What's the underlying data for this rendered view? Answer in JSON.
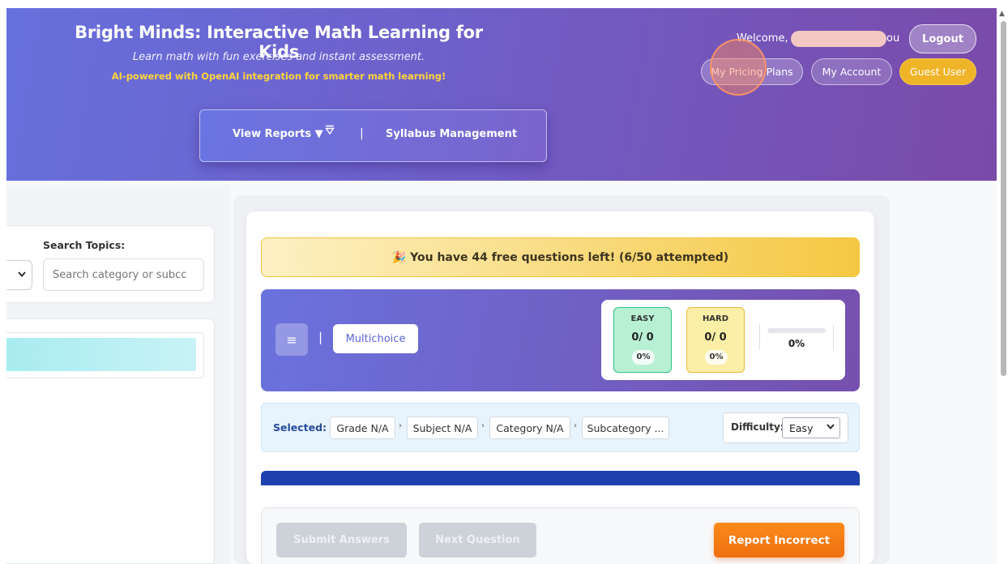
{
  "header": {
    "title": "Bright Minds: Interactive Math Learning for Kids",
    "subtitle": "Learn math with fun exercises and instant assessment.",
    "ai_line": "AI-powered with OpenAI integration for smarter math learning!",
    "nav": {
      "reports": "View Reports ▼",
      "filter_icon": "filter-icon",
      "separator": "|",
      "syllabus": "Syllabus Management"
    },
    "welcome_prefix": "Welcome,",
    "welcome_suffix": "ou",
    "logout": "Logout",
    "pricing": "My Pricing Plans",
    "account": "My Account",
    "guest": "Guest User"
  },
  "sidebar": {
    "search_label": "Search Topics:",
    "search_placeholder": "Search category or subcc",
    "select_caret": "⌄"
  },
  "main": {
    "free_banner": "🎉 You have 44 free questions left! (6/50 attempted)",
    "question_type": "Multichoice",
    "menu_icon": "≡",
    "pipe": "|",
    "stats": {
      "easy": {
        "label": "EASY",
        "score": "0/ 0",
        "pct": "0%"
      },
      "hard": {
        "label": "HARD",
        "score": "0/ 0",
        "pct": "0%"
      },
      "overall_pct": "0%",
      "overall_value": 0
    },
    "selected": {
      "label": "Selected:",
      "crumbs": [
        "Grade N/A",
        "Subject N/A",
        "Category N/A",
        "Subcategory ..."
      ],
      "sep": "›"
    },
    "difficulty": {
      "label": "Difficulty:",
      "value": "Easy",
      "caret": "⌄"
    },
    "actions": {
      "submit": "Submit Answers",
      "next": "Next Question",
      "report": "Report Incorrect"
    }
  },
  "colors": {
    "header_start": "#6670dc",
    "header_end": "#7a4aa9",
    "accent_yellow": "#f0b429",
    "report_orange": "#f57c14"
  }
}
